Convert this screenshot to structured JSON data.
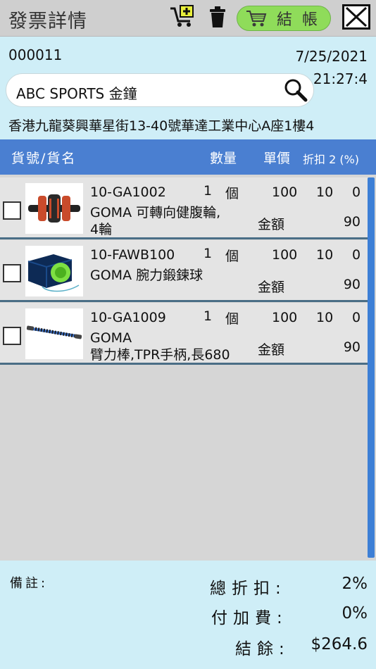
{
  "header": {
    "title": "發票詳情",
    "checkout_label": "結帳",
    "checkout_color": "#8fdc5a"
  },
  "invoice": {
    "number": "000011",
    "date": "7/25/2021",
    "time": "21:27:4",
    "customer": "ABC SPORTS 金鐘",
    "address": "香港九龍葵興華星街13-40號華達工業中心A座1樓4"
  },
  "table": {
    "col_name": "貨號/貨名",
    "col_qty": "數量",
    "col_price": "單價",
    "col_disc": "折扣 2 (%)",
    "header_color": "#4a7fd1"
  },
  "items": [
    {
      "code": "10-GA1002",
      "qty": "1",
      "unit": "個",
      "price": "100",
      "disc1": "10",
      "disc2": "0",
      "desc1": "GOMA 可轉向健腹輪,",
      "desc2": "4輪",
      "amount_label": "金額",
      "amount": "90",
      "image": "ab-wheel"
    },
    {
      "code": "10-FAWB100",
      "qty": "1",
      "unit": "個",
      "price": "100",
      "disc1": "10",
      "disc2": "0",
      "desc1": "GOMA 腕力鍛鍊球",
      "desc2": "",
      "amount_label": "金額",
      "amount": "90",
      "image": "wrist-ball"
    },
    {
      "code": "10-GA1009",
      "qty": "1",
      "unit": "個",
      "price": "100",
      "disc1": "10",
      "disc2": "0",
      "desc1": "GOMA",
      "desc2": "臂力棒,TPR手柄,長680",
      "amount_label": "金額",
      "amount": "90",
      "image": "power-bar"
    }
  ],
  "footer": {
    "remarks_label": "備註:",
    "total_discount_label": "總折扣:",
    "total_discount": "2%",
    "surcharge_label": "付加費:",
    "surcharge": "0%",
    "balance_label": "結餘:",
    "balance": "$264.6"
  }
}
